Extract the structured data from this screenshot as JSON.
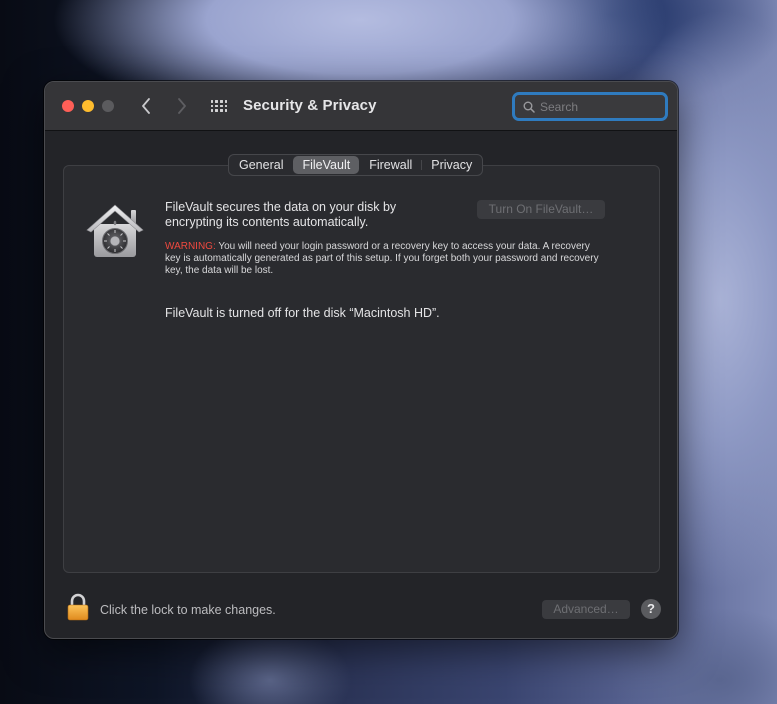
{
  "window": {
    "title": "Security & Privacy",
    "controls": {
      "close": "close-button",
      "minimize": "minimize-button",
      "zoom": "zoom-button"
    },
    "colors": {
      "close": "#fe5f57",
      "minimize": "#febc2e",
      "zoom_disabled": "#5b5b5e",
      "accent": "#2f7bbf",
      "warning": "#f0493f"
    }
  },
  "toolbar": {
    "back_icon": "chevron-left-icon",
    "forward_icon": "chevron-right-icon",
    "show_all_icon": "grid-icon",
    "search": {
      "placeholder": "Search",
      "value": "",
      "icon": "search-icon"
    }
  },
  "tabs": [
    {
      "label": "General",
      "active": false
    },
    {
      "label": "FileVault",
      "active": true
    },
    {
      "label": "Firewall",
      "active": false
    },
    {
      "label": "Privacy",
      "active": false
    }
  ],
  "filevault": {
    "icon": "filevault-house-safe-icon",
    "description": "FileVault secures the data on your disk by encrypting its contents automatically.",
    "turn_on_label": "Turn On FileVault…",
    "turn_on_enabled": false,
    "warning_label": "WARNING:",
    "warning_text": " You will need your login password or a recovery key to access your data. A recovery key is automatically generated as part of this setup. If you forget both your password and recovery key, the data will be lost.",
    "status": "FileVault is turned off for the disk “Macintosh HD”."
  },
  "footer": {
    "lock_icon": "padlock-icon",
    "lock_text": "Click the lock to make changes.",
    "advanced_label": "Advanced…",
    "advanced_enabled": false,
    "help_label": "?"
  }
}
